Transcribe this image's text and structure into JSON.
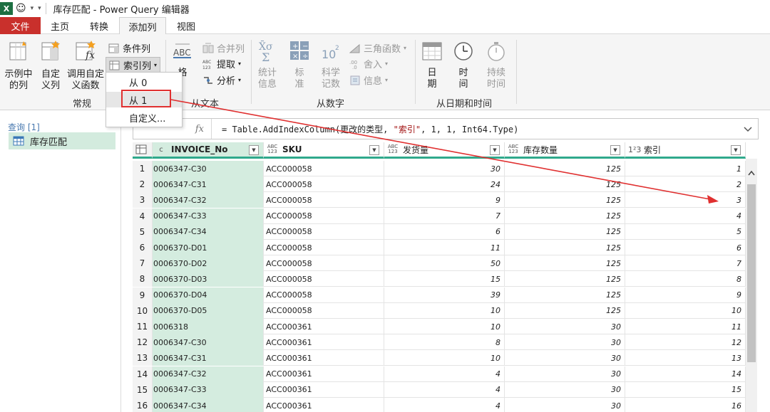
{
  "window": {
    "title": "库存匹配 - Power Query 编辑器",
    "app_logo": "X"
  },
  "tabs": [
    {
      "label": "文件",
      "active": false
    },
    {
      "label": "主页",
      "active": false
    },
    {
      "label": "转换",
      "active": false
    },
    {
      "label": "添加列",
      "active": true
    },
    {
      "label": "视图",
      "active": false
    }
  ],
  "ribbon": {
    "example_col": "示例中\n的列",
    "custom_col": "自定\n义列",
    "invoke_func": "调用自定\n义函数",
    "conditional_col": "条件列",
    "index_col": "索引列",
    "group_general": "常规",
    "format": "格",
    "merge_cols": "合并列",
    "extract": "提取",
    "parse": "分析",
    "abc_icon": "ABC",
    "group_text": "从文本",
    "statistics": "统计\n信息",
    "standard": "标\n准",
    "scientific": "科学\n记数",
    "trig": "三角函数",
    "rounding": "舍入",
    "information": "信息",
    "sci_icon": "10",
    "group_number": "从数字",
    "date": "日\n期",
    "time": "时\n间",
    "duration": "持续\n时间",
    "group_datetime": "从日期和时间"
  },
  "index_menu": {
    "items": [
      "从 0",
      "从 1",
      "自定义..."
    ],
    "highlighted": 1
  },
  "queries": {
    "header": "查询 [1]",
    "items": [
      "库存匹配"
    ]
  },
  "formula": {
    "fx": "fx",
    "prefix": "= Table.AddIndexColumn(更改的类型, ",
    "string": "\"索引\"",
    "suffix": ", 1, 1, Int64.Type)"
  },
  "columns": [
    {
      "type": "c",
      "name": "INVOICE_No"
    },
    {
      "type": "ABC\n123",
      "name": "SKU"
    },
    {
      "type": "ABC\n123",
      "name": "发货量"
    },
    {
      "type": "ABC\n123",
      "name": "库存数量"
    },
    {
      "type": "1²3",
      "name": "索引"
    }
  ],
  "rows": [
    [
      "1",
      "0006347-C30",
      "ACC000058",
      "30",
      "125",
      "1"
    ],
    [
      "2",
      "0006347-C31",
      "ACC000058",
      "24",
      "125",
      "2"
    ],
    [
      "3",
      "0006347-C32",
      "ACC000058",
      "9",
      "125",
      "3"
    ],
    [
      "4",
      "0006347-C33",
      "ACC000058",
      "7",
      "125",
      "4"
    ],
    [
      "5",
      "0006347-C34",
      "ACC000058",
      "6",
      "125",
      "5"
    ],
    [
      "6",
      "0006370-D01",
      "ACC000058",
      "11",
      "125",
      "6"
    ],
    [
      "7",
      "0006370-D02",
      "ACC000058",
      "50",
      "125",
      "7"
    ],
    [
      "8",
      "0006370-D03",
      "ACC000058",
      "15",
      "125",
      "8"
    ],
    [
      "9",
      "0006370-D04",
      "ACC000058",
      "39",
      "125",
      "9"
    ],
    [
      "10",
      "0006370-D05",
      "ACC000058",
      "10",
      "125",
      "10"
    ],
    [
      "11",
      "0006318",
      "ACC000361",
      "10",
      "30",
      "11"
    ],
    [
      "12",
      "0006347-C30",
      "ACC000361",
      "8",
      "30",
      "12"
    ],
    [
      "13",
      "0006347-C31",
      "ACC000361",
      "10",
      "30",
      "13"
    ],
    [
      "14",
      "0006347-C32",
      "ACC000361",
      "4",
      "30",
      "14"
    ],
    [
      "15",
      "0006347-C33",
      "ACC000361",
      "4",
      "30",
      "15"
    ],
    [
      "16",
      "0006347-C34",
      "ACC000361",
      "4",
      "30",
      "16"
    ]
  ],
  "colors": {
    "file_tab": "#c9302c",
    "accent": "#2fa98c",
    "highlight_box": "#e03030",
    "arrow": "#e03030",
    "query_selected": "#d3ebde"
  }
}
